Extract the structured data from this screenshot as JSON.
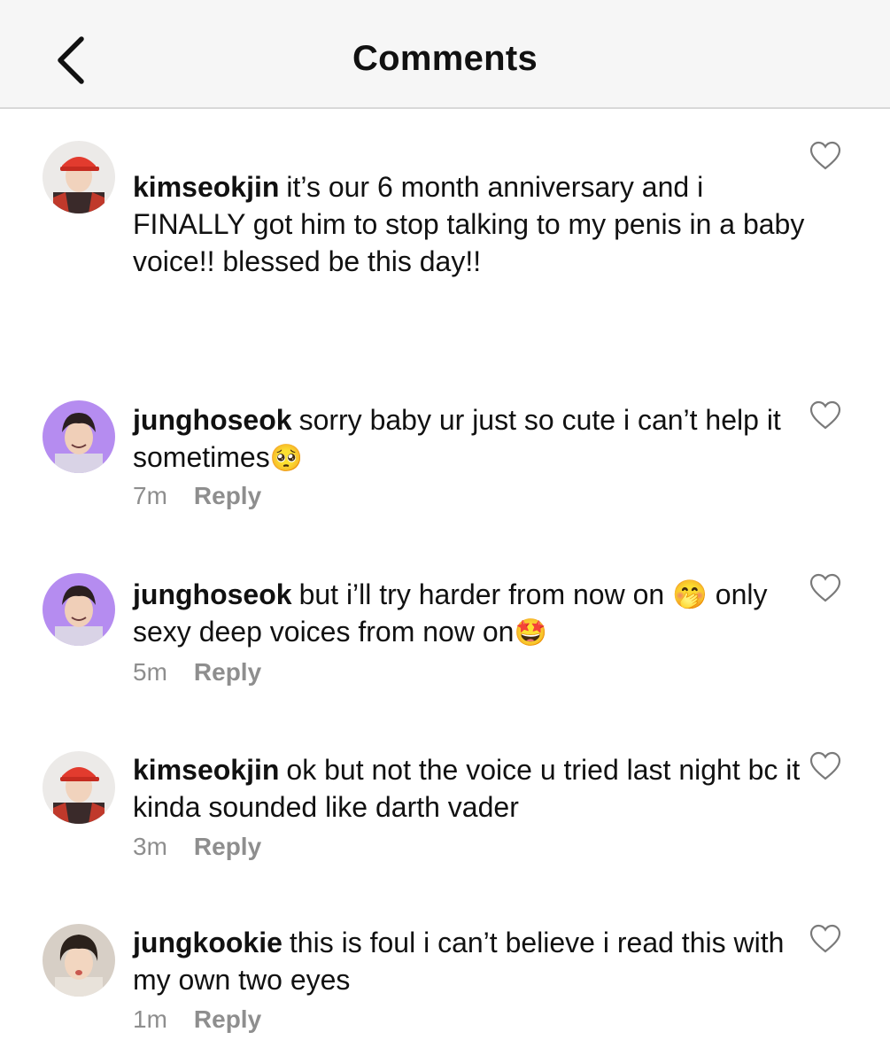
{
  "header": {
    "title": "Comments",
    "back_icon": "chevron-left-icon"
  },
  "comments": [
    {
      "username": "kimseokjin",
      "text": "it’s our 6 month anniversary and i FINALLY got him to stop talking to my penis in a baby voice!! blessed be this day!!",
      "emoji": "",
      "time": "",
      "reply": "",
      "avatar": "avatar-red-cap"
    },
    {
      "username": "junghoseok",
      "text": "sorry baby ur just so cute i can’t help it sometimes",
      "emoji": "🥺",
      "time": "7m",
      "reply": "Reply",
      "avatar": "avatar-purple"
    },
    {
      "username": "junghoseok",
      "text": "but i’ll try harder from now on 🤭 only sexy deep voices from now on",
      "emoji": "🤩",
      "time": "5m",
      "reply": "Reply",
      "avatar": "avatar-purple"
    },
    {
      "username": "kimseokjin",
      "text": "ok but not the voice u tried last night bc it kinda sounded like darth vader",
      "emoji": "",
      "time": "3m",
      "reply": "Reply",
      "avatar": "avatar-red-cap"
    },
    {
      "username": "jungkookie",
      "text": "this is foul i can’t believe i read this with my own two eyes",
      "emoji": "",
      "time": "1m",
      "reply": "Reply",
      "avatar": "avatar-dark-hair"
    }
  ],
  "colors": {
    "header_bg": "#f6f6f6",
    "meta_text": "#8e8e8e",
    "purple_avatar": "#b58cf0",
    "red_cap": "#e23b2e"
  }
}
